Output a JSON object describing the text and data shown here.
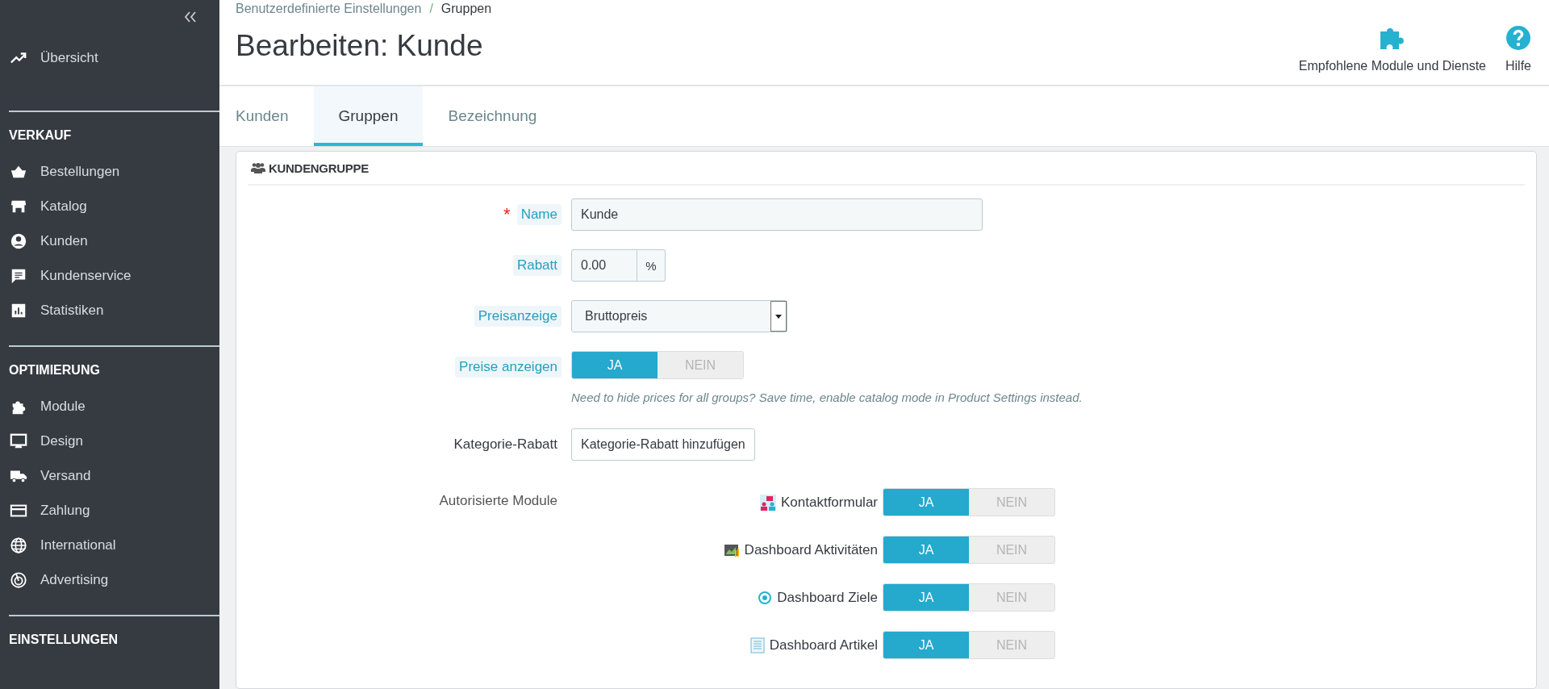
{
  "sidebar": {
    "sections": [
      {
        "items": [
          {
            "label": "Übersicht",
            "selected": false
          }
        ]
      },
      {
        "title": "VERKAUF",
        "items": [
          {
            "label": "Bestellungen",
            "selected": false
          },
          {
            "label": "Katalog",
            "selected": false
          },
          {
            "label": "Kunden",
            "selected": false
          },
          {
            "label": "Kundenservice",
            "selected": false
          },
          {
            "label": "Statistiken",
            "selected": false
          }
        ]
      },
      {
        "title": "OPTIMIERUNG",
        "items": [
          {
            "label": "Module",
            "selected": false
          },
          {
            "label": "Design",
            "selected": false
          },
          {
            "label": "Versand",
            "selected": false
          },
          {
            "label": "Zahlung",
            "selected": false
          },
          {
            "label": "International",
            "selected": false
          },
          {
            "label": "Advertising",
            "selected": false
          }
        ]
      },
      {
        "title": "EINSTELLUNGEN"
      }
    ]
  },
  "breadcrumb": [
    "Benutzerdefinierte Einstellungen",
    "Gruppen"
  ],
  "breadcrumb_separator": "/",
  "title": "Bearbeiten: Kunde",
  "header_actions": [
    {
      "label": "Empfohlene Module und Dienste"
    },
    {
      "label": "Hilfe"
    }
  ],
  "tabs": [
    {
      "label": "Kunden",
      "selected": false
    },
    {
      "label": "Gruppen",
      "selected": true
    },
    {
      "label": "Bezeichnung",
      "selected": false
    }
  ],
  "panel": {
    "title": "KUNDENGRUPPE",
    "fields": [
      {
        "kind": "text",
        "label": "Name",
        "required_mark": "*",
        "hint_label": true,
        "value": "Kunde"
      },
      {
        "kind": "addon",
        "label": "Rabatt",
        "hint_label": true,
        "value": "0.00",
        "suffix": "%"
      },
      {
        "kind": "select",
        "label": "Preisanzeige",
        "hint_label": true,
        "value": "Bruttopreis"
      },
      {
        "kind": "switch",
        "label": "Preise anzeigen",
        "hint_label": true,
        "options": [
          {
            "label": "JA",
            "selected": true
          },
          {
            "label": "NEIN",
            "selected": false
          }
        ],
        "help": "Need to hide prices for all groups? Save time, enable catalog mode in Product Settings instead."
      },
      {
        "kind": "button",
        "label": "Kategorie-Rabatt",
        "hint_label": false,
        "button": "Kategorie-Rabatt hinzufügen"
      }
    ],
    "modules_label": "Autorisierte Module",
    "modules": [
      {
        "name": "Kontaktformular",
        "options": [
          {
            "label": "JA",
            "selected": true
          },
          {
            "label": "NEIN",
            "selected": false
          }
        ]
      },
      {
        "name": "Dashboard Aktivitäten",
        "options": [
          {
            "label": "JA",
            "selected": true
          },
          {
            "label": "NEIN",
            "selected": false
          }
        ]
      },
      {
        "name": "Dashboard Ziele",
        "options": [
          {
            "label": "JA",
            "selected": true
          },
          {
            "label": "NEIN",
            "selected": false
          }
        ]
      },
      {
        "name": "Dashboard Artikel",
        "options": [
          {
            "label": "JA",
            "selected": true
          },
          {
            "label": "NEIN",
            "selected": false
          }
        ]
      }
    ]
  }
}
